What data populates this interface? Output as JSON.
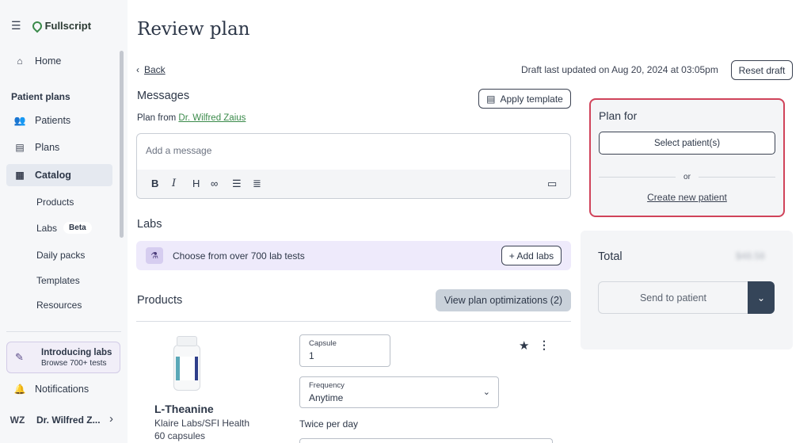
{
  "sidebar": {
    "brand": "Fullscript",
    "home": "Home",
    "section_title": "Patient plans",
    "items": [
      {
        "label": "Patients"
      },
      {
        "label": "Plans"
      },
      {
        "label": "Catalog"
      }
    ],
    "sub_items": [
      {
        "label": "Products"
      },
      {
        "label": "Labs",
        "badge": "Beta"
      },
      {
        "label": "Daily packs"
      },
      {
        "label": "Templates"
      },
      {
        "label": "Resources"
      }
    ],
    "promo": {
      "title": "Introducing labs",
      "subtitle": "Browse 700+ tests"
    },
    "notifications": "Notifications",
    "user": {
      "initials": "WZ",
      "name": "Dr. Wilfred Z..."
    }
  },
  "header": {
    "title": "Review plan",
    "back": "Back",
    "draft_text": "Draft last updated on Aug 20, 2024 at 03:05pm",
    "reset_draft": "Reset draft"
  },
  "messages": {
    "title": "Messages",
    "apply_template": "Apply template",
    "plan_from_prefix": "Plan from",
    "doctor_name": "Dr. Wilfred Zaius",
    "placeholder": "Add a message",
    "toolbar": [
      "B",
      "I",
      "H"
    ]
  },
  "labs": {
    "title": "Labs",
    "choose_text": "Choose from over 700 lab tests",
    "add_labs": "+ Add labs"
  },
  "products": {
    "title": "Products",
    "view_optimizations": "View plan optimizations (2)",
    "item": {
      "name": "L-Theanine",
      "brand": "Klaire Labs/SFI Health",
      "size": "60 capsules",
      "dosage_label": "Capsule",
      "dosage_value": "1",
      "frequency_label": "Frequency",
      "frequency_value": "Anytime",
      "schedule": "Twice per day"
    }
  },
  "plan_for": {
    "title": "Plan for",
    "select_patients": "Select patient(s)",
    "or": "or",
    "create_new": "Create new patient"
  },
  "total": {
    "label": "Total",
    "value": "$48.58",
    "send": "Send to patient"
  },
  "colors": {
    "accent_green": "#3a8a4a",
    "highlight_red": "#d0435a",
    "dark_navy": "#354559",
    "labs_purple": "#eeeafb"
  }
}
